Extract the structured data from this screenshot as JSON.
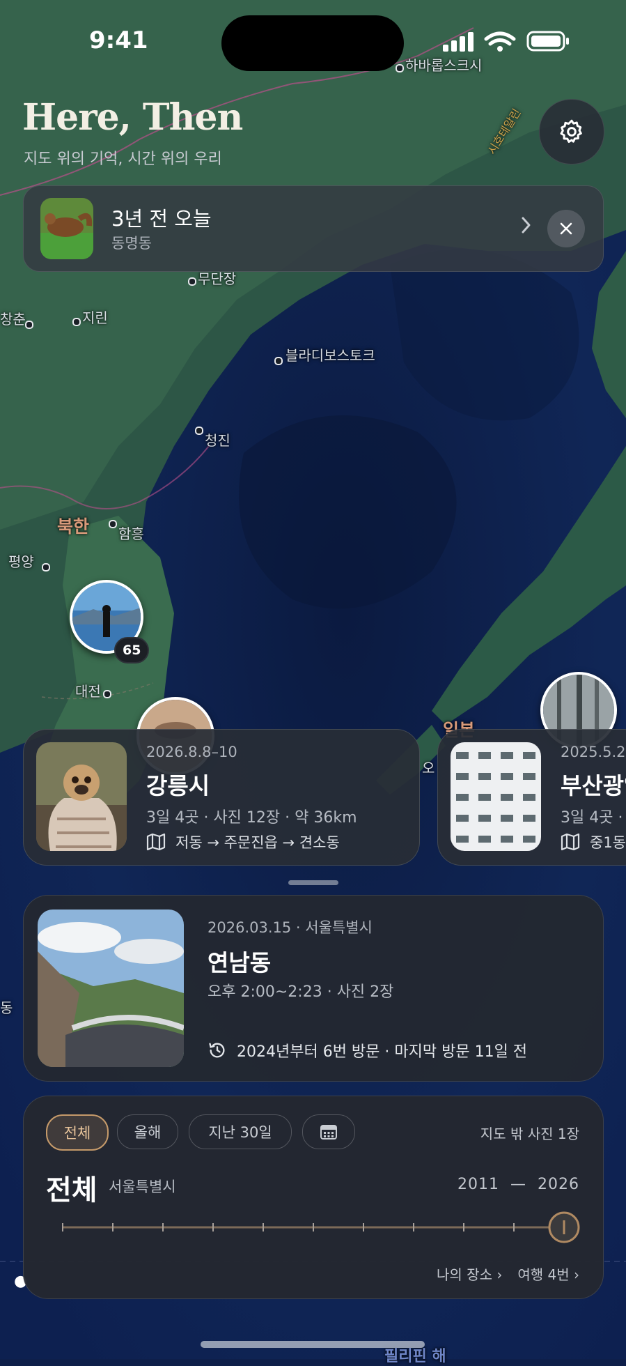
{
  "status_bar": {
    "time": "9:41"
  },
  "header": {
    "title": "Here, Then",
    "subtitle": "지도 위의 기억, 시간 위의 우리"
  },
  "memory": {
    "title": "3년 전 오늘",
    "subtitle": "동명동"
  },
  "map_labels": {
    "khabarovsk": "하바롭스크시",
    "sikhote": "시호테알린",
    "mudanjiang": "무단장",
    "changchun": "창춘",
    "jilin": "지린",
    "vladivostok": "블라디보스토크",
    "chongjin": "청진",
    "north_korea": "북한",
    "hamhung": "함흥",
    "pyongyang": "평양",
    "daejeon": "대전",
    "japan": "일본",
    "o": "오",
    "dong": "동",
    "philippine_sea": "필리핀 해"
  },
  "clusters": [
    {
      "count": "65"
    }
  ],
  "trips": [
    {
      "date": "2026.8.8–10",
      "title": "강릉시",
      "stats": "3일 4곳 · 사진 12장 · 약 36km",
      "route": "저동 → 주문진읍 → 견소동"
    },
    {
      "date": "2025.5.2",
      "title": "부산광역",
      "stats": "3일 4곳 ·",
      "route": "중1동"
    }
  ],
  "place": {
    "date": "2026.03.15 · 서울특별시",
    "title": "연남동",
    "time": "오후 2:00~2:23 · 사진 2장",
    "visits": "2024년부터 6번 방문 · 마지막 방문 11일 전"
  },
  "filter": {
    "chips": [
      "전체",
      "올해",
      "지난 30일"
    ],
    "outside": "지도 밖 사진 1장",
    "title": "전체",
    "region": "서울특별시",
    "range_start": "2011",
    "range_dash": "—",
    "range_end": "2026",
    "link_places": "나의 장소",
    "link_trips": "여행 4번"
  },
  "colors": {
    "accent": "#c59a6a",
    "sea": "#0e1f4a",
    "land": "#2f5a4a"
  }
}
